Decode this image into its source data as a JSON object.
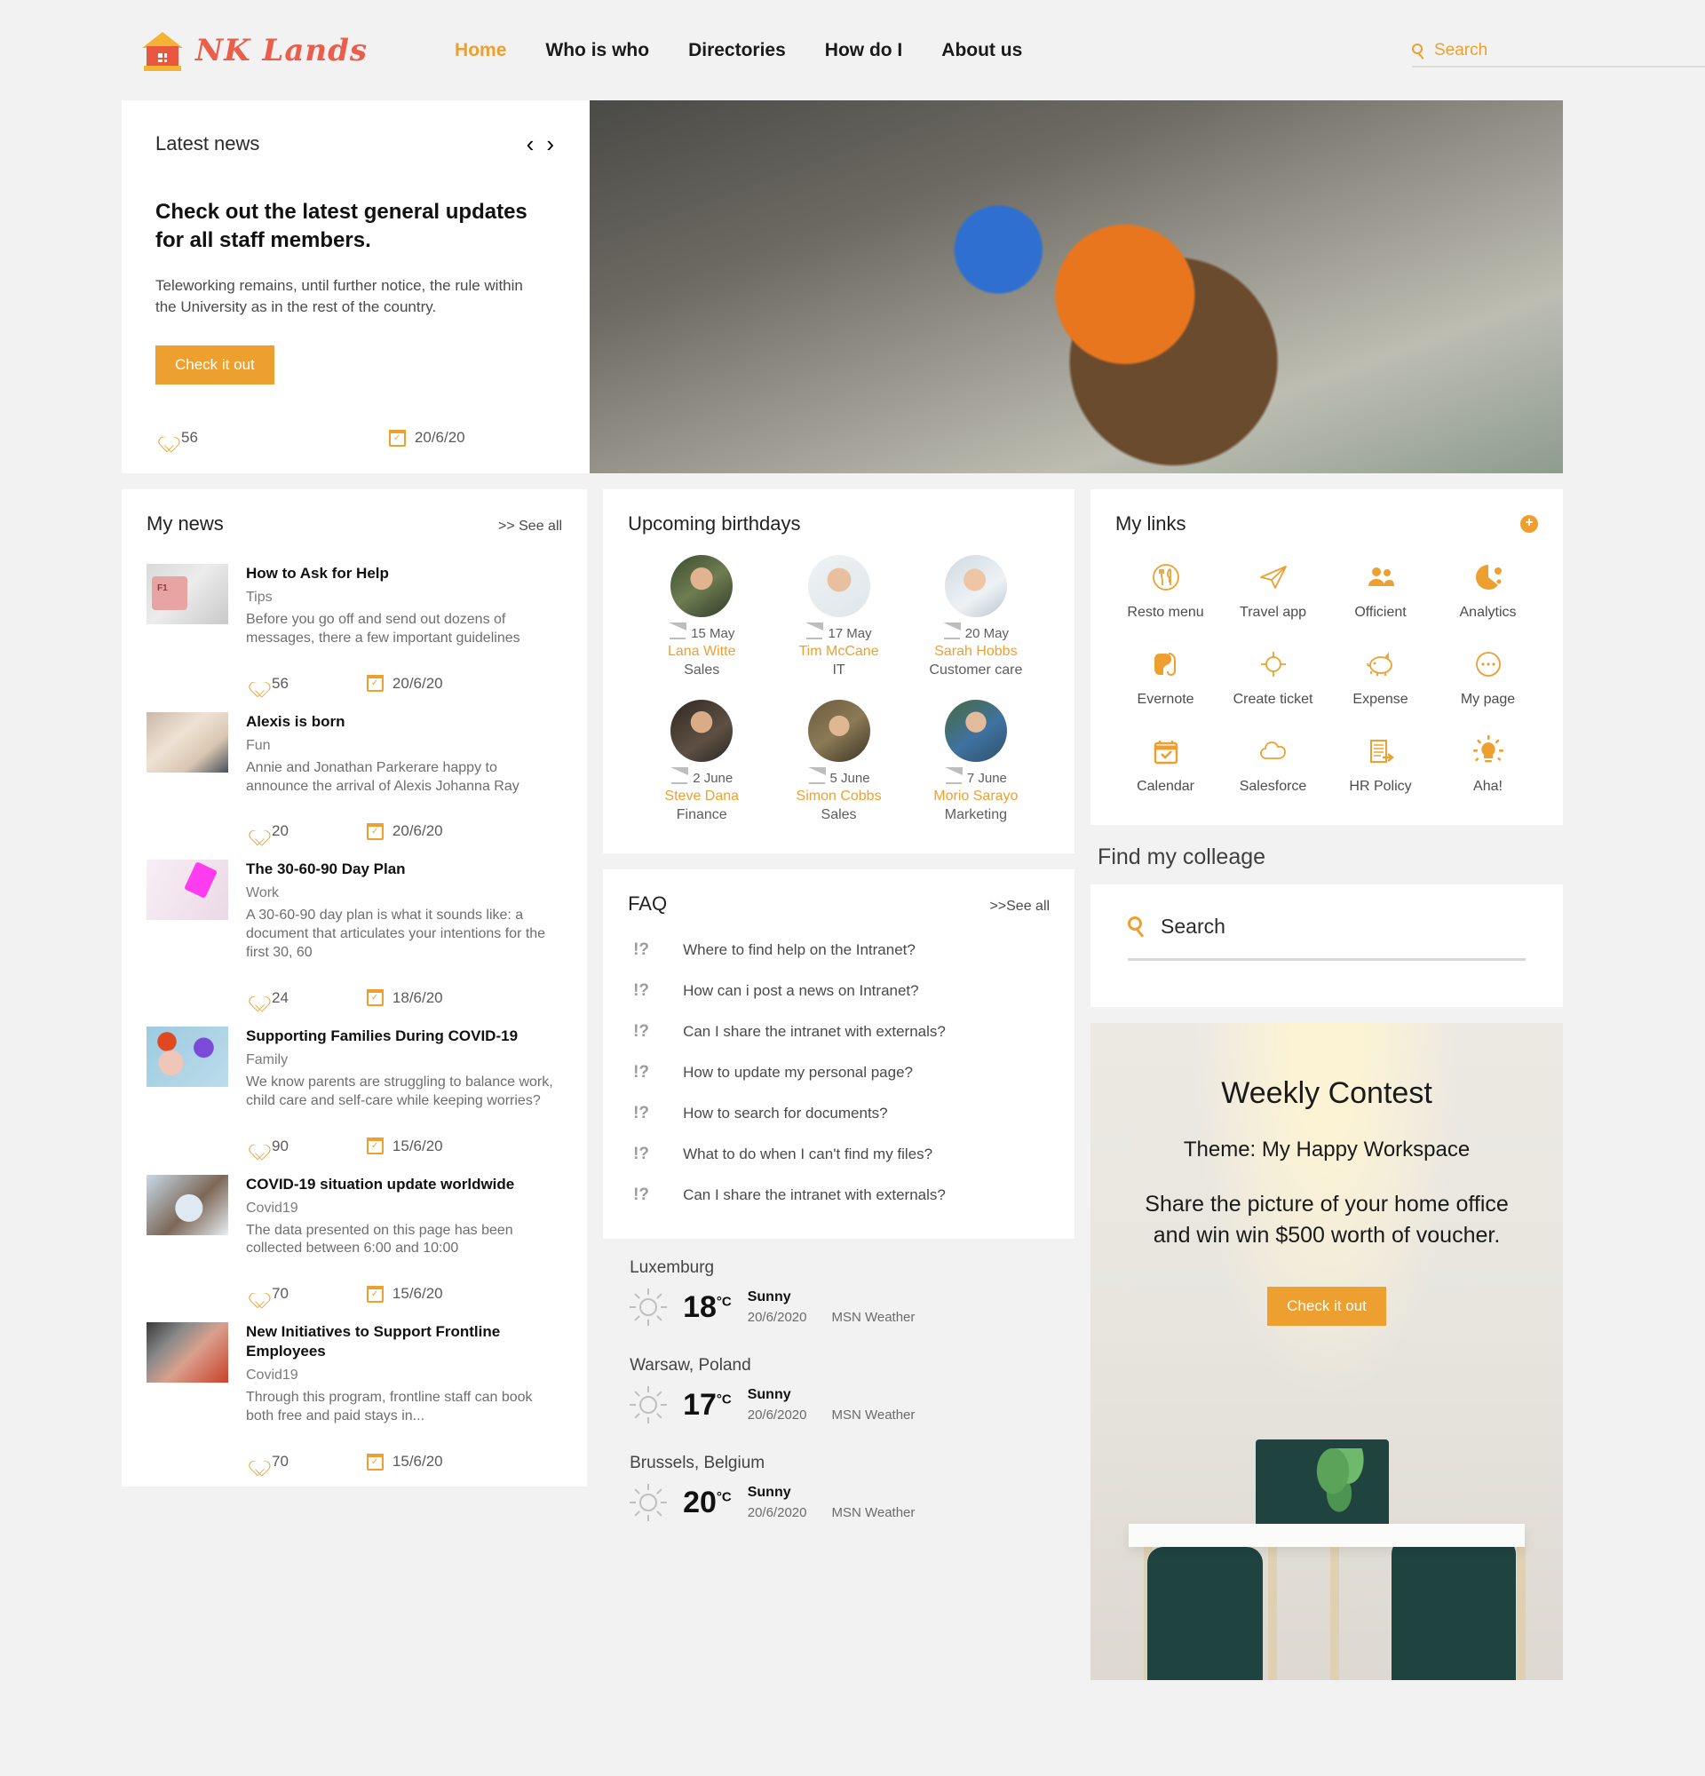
{
  "header": {
    "brand": "NK Lands",
    "logo_icon": "house-icon",
    "nav": [
      {
        "label": "Home",
        "active": true
      },
      {
        "label": "Who is who",
        "active": false
      },
      {
        "label": "Directories",
        "active": false
      },
      {
        "label": "How do I",
        "active": false
      },
      {
        "label": "About us",
        "active": false
      }
    ],
    "search": {
      "placeholder": "Search",
      "value": "",
      "icon": "search-icon"
    }
  },
  "hero": {
    "title": "Latest news",
    "prev_icon": "chevron-left-icon",
    "next_icon": "chevron-right-icon",
    "headline": "Check out the latest general updates for all staff members.",
    "body": "Teleworking remains, until further notice, the rule within the University as in the rest of the country.",
    "cta": "Check it out",
    "likes": "56",
    "date": "20/6/20",
    "image_alt": "construction worker with blue hard hat"
  },
  "my_news": {
    "title": "My news",
    "see_all": ">> See all",
    "items": [
      {
        "title": "How to Ask for Help",
        "category": "Tips",
        "desc": "Before you go off and send out dozens of messages, there a few important guidelines",
        "likes": "56",
        "date": "20/6/20",
        "thumb": "th-keyboard"
      },
      {
        "title": "Alexis is born",
        "category": "Fun",
        "desc": "Annie and Jonathan Parkerare happy to announce the arrival of Alexis Johanna Ray",
        "likes": "20",
        "date": "20/6/20",
        "thumb": "th-baby"
      },
      {
        "title": "The 30-60-90 Day Plan",
        "category": "Work",
        "desc": "A 30-60-90 day plan is what it sounds like: a document that articulates your intentions for the first 30, 60",
        "likes": "24",
        "date": "18/6/20",
        "thumb": "th-plan"
      },
      {
        "title": "Supporting Families During COVID-19",
        "category": "Family",
        "desc": "We know parents are struggling to balance work, child care and self-care while keeping worries?",
        "likes": "90",
        "date": "15/6/20",
        "thumb": "th-covid"
      },
      {
        "title": "COVID-19 situation update worldwide",
        "category": "Covid19",
        "desc": "The data presented on this page has been collected between 6:00 and 10:00",
        "likes": "70",
        "date": "15/6/20",
        "thumb": "th-mask"
      },
      {
        "title": "New Initiatives to Support Frontline Employees",
        "category": "Covid19",
        "desc": "Through this program, frontline staff can book both free and paid stays in...",
        "likes": "70",
        "date": "15/6/20",
        "thumb": "th-woman"
      }
    ]
  },
  "birthdays": {
    "title": "Upcoming birthdays",
    "people": [
      {
        "date": "15 May",
        "name": "Lana Witte",
        "department": "Sales",
        "avatar": "av1"
      },
      {
        "date": "17 May",
        "name": "Tim McCane",
        "department": "IT",
        "avatar": "av2"
      },
      {
        "date": "20 May",
        "name": "Sarah Hobbs",
        "department": "Customer care",
        "avatar": "av3"
      },
      {
        "date": "2 June",
        "name": "Steve Dana",
        "department": "Finance",
        "avatar": "av4"
      },
      {
        "date": "5 June",
        "name": "Simon Cobbs",
        "department": "Sales",
        "avatar": "av5"
      },
      {
        "date": "7 June",
        "name": "Morio Sarayo",
        "department": "Marketing",
        "avatar": "av6"
      }
    ]
  },
  "faq": {
    "title": "FAQ",
    "see_all": ">>See all",
    "marker": "!?",
    "questions": [
      "Where to find help on the Intranet?",
      "How can i post a news on Intranet?",
      "Can I share the intranet with  externals?",
      "How to update my personal page?",
      "How to search for documents?",
      "What to do when I can't find my files?",
      "Can I share the intranet with  externals?"
    ]
  },
  "weather": [
    {
      "city": "Luxemburg",
      "temp": "18",
      "unit": "°C",
      "condition": "Sunny",
      "date": "20/6/2020",
      "source": "MSN Weather",
      "icon": "sun-icon"
    },
    {
      "city": "Warsaw, Poland",
      "temp": "17",
      "unit": "°C",
      "condition": "Sunny",
      "date": "20/6/2020",
      "source": "MSN Weather",
      "icon": "sun-icon"
    },
    {
      "city": "Brussels, Belgium",
      "temp": "20",
      "unit": "°C",
      "condition": "Sunny",
      "date": "20/6/2020",
      "source": "MSN Weather",
      "icon": "sun-icon"
    }
  ],
  "my_links": {
    "title": "My links",
    "add_label": "+",
    "items": [
      {
        "label": "Resto menu",
        "icon": "restaurant-icon"
      },
      {
        "label": "Travel app",
        "icon": "paper-plane-icon"
      },
      {
        "label": "Officient",
        "icon": "people-icon"
      },
      {
        "label": "Analytics",
        "icon": "pie-chart-icon"
      },
      {
        "label": "Evernote",
        "icon": "elephant-icon"
      },
      {
        "label": "Create ticket",
        "icon": "target-icon"
      },
      {
        "label": "Expense",
        "icon": "piggy-bank-icon"
      },
      {
        "label": "My page",
        "icon": "dots-circle-icon"
      },
      {
        "label": "Calendar",
        "icon": "calendar-check-icon"
      },
      {
        "label": "Salesforce",
        "icon": "cloud-icon"
      },
      {
        "label": "HR Policy",
        "icon": "document-arrow-icon"
      },
      {
        "label": "Aha!",
        "icon": "lightbulb-sun-icon"
      }
    ]
  },
  "find_colleague": {
    "title": "Find my colleage",
    "search_label": "Search",
    "placeholder": "Search",
    "icon": "search-icon"
  },
  "contest": {
    "title": "Weekly Contest",
    "theme": "Theme: My Happy Workspace",
    "description": "Share the picture of your home office and win win $500 worth of voucher.",
    "cta": "Check it out"
  },
  "colors": {
    "accent": "#eda02f",
    "brand": "#eb5e4b",
    "page_bg": "#f2f2f2",
    "card_bg": "#ffffff"
  }
}
